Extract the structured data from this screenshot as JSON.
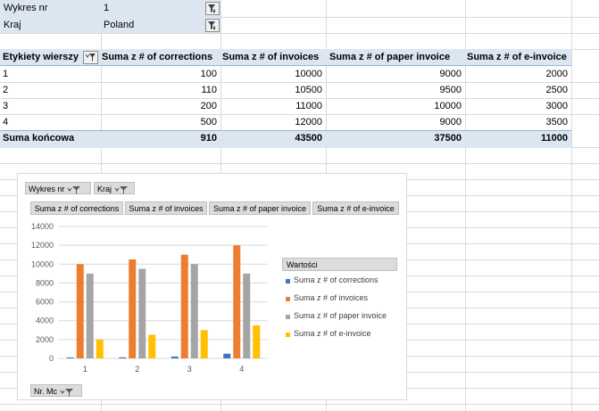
{
  "filters": [
    {
      "label": "Wykres nr",
      "value": "1"
    },
    {
      "label": "Kraj",
      "value": "Poland"
    }
  ],
  "pivot": {
    "row_label": "Etykiety wierszy",
    "columns": [
      "Suma z # of corrections",
      "Suma z # of invoices",
      "Suma z # of paper invoice",
      "Suma z # of e-invoice"
    ],
    "rows": [
      {
        "label": "1",
        "values": [
          "100",
          "10000",
          "9000",
          "2000"
        ]
      },
      {
        "label": "2",
        "values": [
          "110",
          "10500",
          "9500",
          "2500"
        ]
      },
      {
        "label": "3",
        "values": [
          "200",
          "11000",
          "10000",
          "3000"
        ]
      },
      {
        "label": "4",
        "values": [
          "500",
          "12000",
          "9000",
          "3500"
        ]
      }
    ],
    "total": {
      "label": "Suma końcowa",
      "values": [
        "910",
        "43500",
        "37500",
        "11000"
      ]
    }
  },
  "chart": {
    "filter_buttons": [
      "Wykres nr",
      "Kraj"
    ],
    "value_buttons": [
      "Suma z # of corrections",
      "Suma z # of invoices",
      "Suma z # of paper invoice",
      "Suma z # of e-invoice"
    ],
    "axis_button": "Nr. Mc",
    "legend_title": "Wartości",
    "colors": [
      "#4472c4",
      "#ed7d31",
      "#a5a5a5",
      "#ffc000"
    ]
  },
  "chart_data": {
    "type": "bar",
    "categories": [
      "1",
      "2",
      "3",
      "4"
    ],
    "series": [
      {
        "name": "Suma z # of corrections",
        "values": [
          100,
          110,
          200,
          500
        ]
      },
      {
        "name": "Suma z # of invoices",
        "values": [
          10000,
          10500,
          11000,
          12000
        ]
      },
      {
        "name": "Suma z # of paper invoice",
        "values": [
          9000,
          9500,
          10000,
          9000
        ]
      },
      {
        "name": "Suma z # of e-invoice",
        "values": [
          2000,
          2500,
          3000,
          3500
        ]
      }
    ],
    "y_ticks": [
      "0",
      "2000",
      "4000",
      "6000",
      "8000",
      "10000",
      "12000",
      "14000"
    ],
    "ylim": [
      0,
      14000
    ],
    "grid": true,
    "legend_position": "right"
  }
}
